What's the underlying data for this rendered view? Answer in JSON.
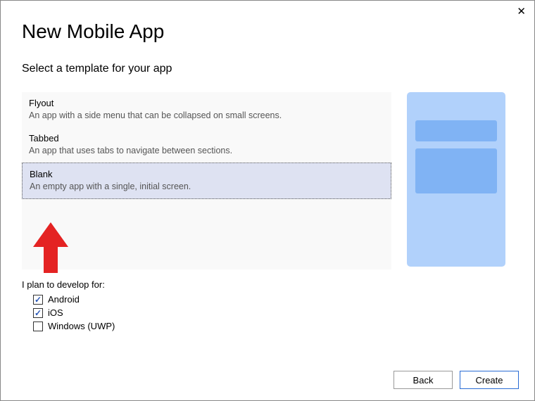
{
  "dialog": {
    "title": "New Mobile App",
    "subtitle": "Select a template for your app"
  },
  "templates": [
    {
      "name": "Flyout",
      "desc": "An app with a side menu that can be collapsed on small screens."
    },
    {
      "name": "Tabbed",
      "desc": "An app that uses tabs to navigate between sections."
    },
    {
      "name": "Blank",
      "desc": "An empty app with a single, initial screen.",
      "selected": true
    }
  ],
  "develop_for": {
    "label": "I plan to develop for:",
    "options": [
      {
        "label": "Android",
        "checked": true
      },
      {
        "label": "iOS",
        "checked": true
      },
      {
        "label": "Windows (UWP)",
        "checked": false
      }
    ]
  },
  "buttons": {
    "back": "Back",
    "create": "Create"
  },
  "annotation": {
    "arrow_color": "#e42323"
  }
}
